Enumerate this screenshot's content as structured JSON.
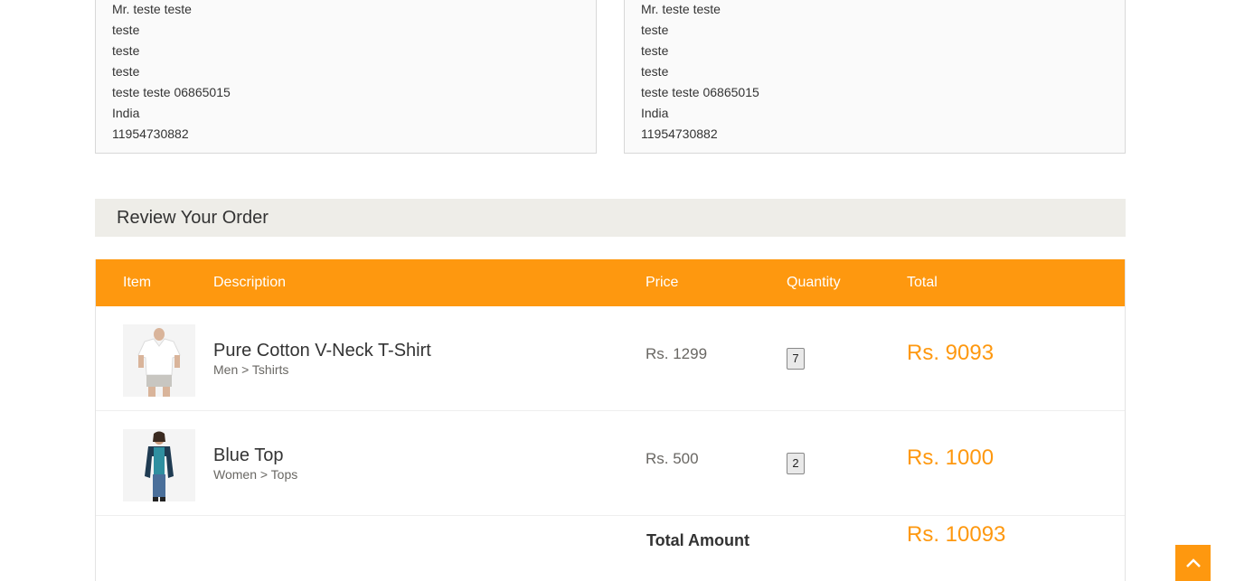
{
  "billing_address": {
    "lines": [
      "Mr. teste teste",
      "teste",
      "teste",
      "teste",
      "teste teste 06865015",
      "India",
      "11954730882"
    ]
  },
  "delivery_address": {
    "lines": [
      "Mr. teste teste",
      "teste",
      "teste",
      "teste",
      "teste teste 06865015",
      "India",
      "11954730882"
    ]
  },
  "review": {
    "heading": "Review Your Order"
  },
  "table": {
    "headers": {
      "item": "Item",
      "description": "Description",
      "price": "Price",
      "quantity": "Quantity",
      "total": "Total"
    },
    "rows": [
      {
        "image_icon": "tshirt-product-image",
        "name": "Pure Cotton V-Neck T-Shirt",
        "category": "Men > Tshirts",
        "price": "Rs. 1299",
        "quantity": "7",
        "total": "Rs. 9093"
      },
      {
        "image_icon": "top-product-image",
        "name": "Blue Top",
        "category": "Women > Tops",
        "price": "Rs. 500",
        "quantity": "2",
        "total": "Rs. 1000"
      }
    ],
    "total_label": "Total Amount",
    "total_value": "Rs. 10093"
  },
  "scroll_up": {
    "icon": "chevron-up-icon"
  },
  "colors": {
    "accent": "#fe980f",
    "heading_bg": "#eeede8"
  }
}
